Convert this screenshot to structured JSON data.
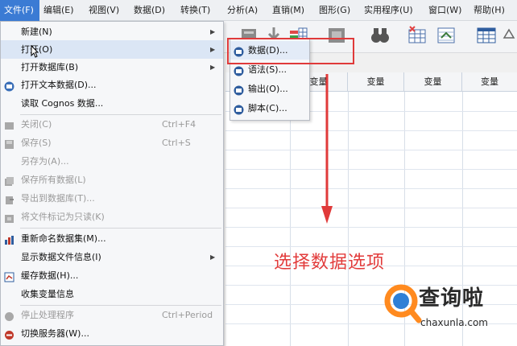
{
  "menubar": {
    "items": [
      "文件(F)",
      "编辑(E)",
      "视图(V)",
      "数据(D)",
      "转换(T)",
      "分析(A)",
      "直销(M)",
      "图形(G)",
      "实用程序(U)",
      "窗口(W)",
      "帮助(H)"
    ]
  },
  "grid": {
    "headers": [
      "变量",
      "变量",
      "变量",
      "变量"
    ]
  },
  "file_menu": {
    "items": [
      {
        "label": "新建(N)",
        "shortcut": "",
        "submenu": true
      },
      {
        "label": "打开(O)",
        "shortcut": "",
        "submenu": true
      },
      {
        "label": "打开数据库(B)",
        "shortcut": "",
        "submenu": true
      },
      {
        "label": "打开文本数据(D)...",
        "shortcut": ""
      },
      {
        "label": "读取 Cognos 数据...",
        "shortcut": ""
      },
      {
        "label": "关闭(C)",
        "shortcut": "Ctrl+F4"
      },
      {
        "label": "保存(S)",
        "shortcut": "Ctrl+S"
      },
      {
        "label": "另存为(A)...",
        "shortcut": ""
      },
      {
        "label": "保存所有数据(L)",
        "shortcut": ""
      },
      {
        "label": "导出到数据库(T)...",
        "shortcut": ""
      },
      {
        "label": "将文件标记为只读(K)",
        "shortcut": ""
      },
      {
        "label": "重新命名数据集(M)...",
        "shortcut": ""
      },
      {
        "label": "显示数据文件信息(I)",
        "shortcut": "",
        "submenu": true
      },
      {
        "label": "缓存数据(H)...",
        "shortcut": ""
      },
      {
        "label": "收集变量信息",
        "shortcut": ""
      },
      {
        "label": "停止处理程序",
        "shortcut": "Ctrl+Period"
      },
      {
        "label": "切换服务器(W)...",
        "shortcut": ""
      }
    ]
  },
  "open_submenu": {
    "items": [
      "数据(D)...",
      "语法(S)...",
      "输出(O)...",
      "脚本(C)..."
    ]
  },
  "annotation": {
    "caption": "选择数据选项",
    "color": "#e23c3c"
  },
  "watermark": {
    "text": "查询啦",
    "url": "chaxunla.com"
  },
  "colors": {
    "menu_active": "#3b7bd4",
    "highlight_box": "#e03a3a"
  }
}
